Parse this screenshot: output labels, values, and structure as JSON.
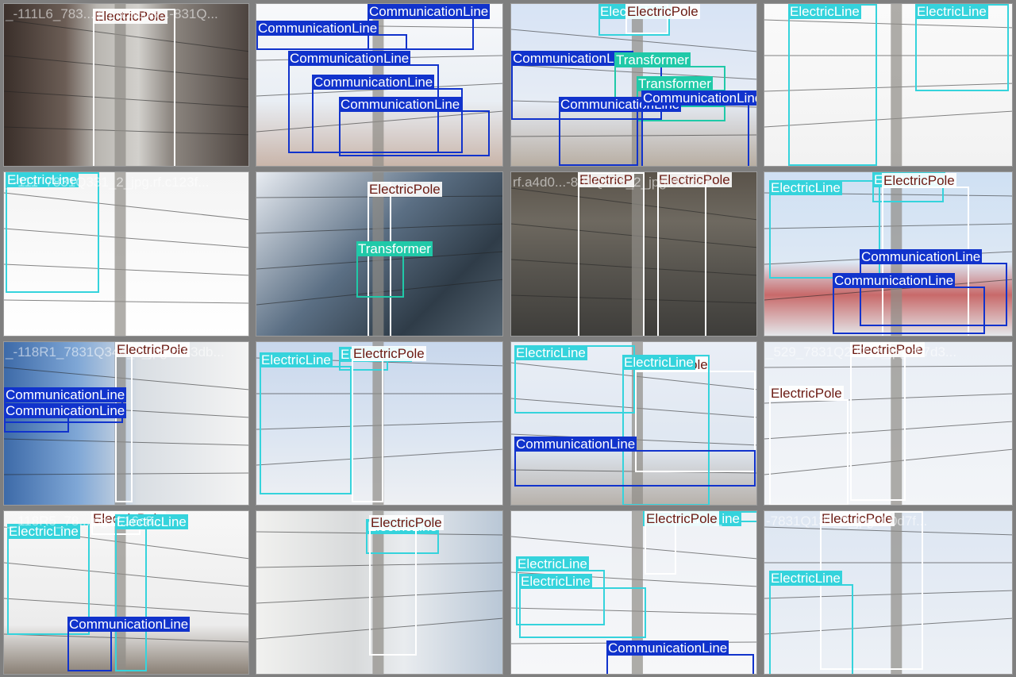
{
  "colors": {
    "background": "#7f7f7f",
    "ElectricPole": "#ffffff",
    "ElectricPole_text": "#6b1a12",
    "ElectricLine": "#35d3dc",
    "ElectricLine_text": "#ffffff",
    "CommunicationLine": "#1133cc",
    "CommunicationLine_text": "#ffffff",
    "Transformer": "#20c9a8",
    "Transformer_text": "#ffffff"
  },
  "tiles": [
    {
      "filename": "_-111L6_783...jpg.rf.b608...-831Q...",
      "scene": "concrete-pole-closeup",
      "labels": [
        {
          "cls": "ElectricPole",
          "text": "ElectricPole"
        }
      ]
    },
    {
      "filename": "",
      "scene": "sky-wires-building",
      "labels": [
        {
          "cls": "CommunicationLine",
          "text": "CommunicationLine"
        },
        {
          "cls": "CommunicationLine",
          "text": "CommunicationLine"
        },
        {
          "cls": "CommunicationLine",
          "text": "CommunicationLine"
        },
        {
          "cls": "CommunicationLine",
          "text": "CommunicationLine"
        },
        {
          "cls": "CommunicationLine",
          "text": "CommunicationLine"
        }
      ]
    },
    {
      "filename": "",
      "scene": "sky-pole-lamp",
      "labels": [
        {
          "cls": "ElectricLine",
          "text": "ElectricLine"
        },
        {
          "cls": "ElectricPole",
          "text": "ElectricPole"
        },
        {
          "cls": "CommunicationLine",
          "text": "CommunicationLine"
        },
        {
          "cls": "Transformer",
          "text": "Transformer"
        },
        {
          "cls": "Transformer",
          "text": "Transformer"
        },
        {
          "cls": "CommunicationLine",
          "text": "CommunicationLine"
        },
        {
          "cls": "CommunicationLine",
          "text": "CommunicationLine"
        }
      ]
    },
    {
      "filename": "",
      "scene": "insulator-closeup-bright",
      "labels": [
        {
          "cls": "ElectricLine",
          "text": "ElectricLine"
        },
        {
          "cls": "ElectricLine",
          "text": "ElectricLine"
        }
      ]
    },
    {
      "filename": "_-111_7831Q331_2_jpg.rf.c123f...",
      "scene": "insulator-dark",
      "labels": [
        {
          "cls": "ElectricLine",
          "text": "ElectricLine"
        }
      ]
    },
    {
      "filename": "",
      "scene": "blue-building",
      "labels": [
        {
          "cls": "ElectricPole",
          "text": "ElectricPole"
        },
        {
          "cls": "Transformer",
          "text": "Transformer"
        }
      ]
    },
    {
      "filename": "rf.a4d0...-831Q462_2_jpg.rf.0dec...",
      "scene": "stone-wall-poles",
      "labels": [
        {
          "cls": "ElectricPole",
          "text": "ElectricP"
        },
        {
          "cls": "ElectricPole",
          "text": "ElectricPole"
        }
      ]
    },
    {
      "filename": "",
      "scene": "sky-red-sign",
      "labels": [
        {
          "cls": "ElectricLine",
          "text": "ElectricLine"
        },
        {
          "cls": "ElectricLine",
          "text": "ElectricLine"
        },
        {
          "cls": "ElectricPole",
          "text": "ElectricPole"
        },
        {
          "cls": "CommunicationLine",
          "text": "CommunicationLine"
        },
        {
          "cls": "CommunicationLine",
          "text": "CommunicationLine"
        }
      ]
    },
    {
      "filename": "_-118R1_7831Q344_2_jpg.rf.83db...",
      "scene": "glass-building",
      "labels": [
        {
          "cls": "ElectricPole",
          "text": "ElectricPole"
        },
        {
          "cls": "CommunicationLine",
          "text": "CommunicationLine"
        },
        {
          "cls": "CommunicationLine",
          "text": "CommunicationLine"
        }
      ]
    },
    {
      "filename": "",
      "scene": "sky-pole-crossarms",
      "labels": [
        {
          "cls": "ElectricLine",
          "text": "ElectricLine"
        },
        {
          "cls": "ElectricLine",
          "text": "ElectricLine"
        },
        {
          "cls": "ElectricPole",
          "text": "ElectricPole"
        }
      ]
    },
    {
      "filename": "",
      "scene": "sky-wires-trees",
      "labels": [
        {
          "cls": "ElectricLine",
          "text": "ElectricLine"
        },
        {
          "cls": "ElectricPole",
          "text": "ElectricPole"
        },
        {
          "cls": "ElectricLine",
          "text": "ElectricLine"
        },
        {
          "cls": "CommunicationLine",
          "text": "CommunicationLine"
        }
      ]
    },
    {
      "filename": "_529_7831Q232_2_jpg.rf.7d3...",
      "scene": "sky-insulators",
      "labels": [
        {
          "cls": "ElectricPole",
          "text": "ElectricPole"
        },
        {
          "cls": "ElectricPole",
          "text": "ElectricPole"
        }
      ]
    },
    {
      "filename": "_-118R5_78...jpg.rf.16c8...",
      "scene": "sky-trees-pole",
      "labels": [
        {
          "cls": "ElectricLine",
          "text": "ElectricLine"
        },
        {
          "cls": "ElectricPole",
          "text": "ElectricPole"
        },
        {
          "cls": "ElectricLine",
          "text": "ElectricLine"
        },
        {
          "cls": "CommunicationLine",
          "text": "CommunicationLine"
        }
      ]
    },
    {
      "filename": "",
      "scene": "white-buildings-pole",
      "labels": [
        {
          "cls": "ElectricLine",
          "text": "ElectricLine"
        },
        {
          "cls": "ElectricPole",
          "text": "ElectricPole"
        }
      ]
    },
    {
      "filename": "",
      "scene": "sky-pole-wires",
      "labels": [
        {
          "cls": "ElectricLine",
          "text": "ElectricLine_ine"
        },
        {
          "cls": "ElectricPole",
          "text": "ElectricPole"
        },
        {
          "cls": "ElectricLine",
          "text": "ElectricLine"
        },
        {
          "cls": "ElectricLine",
          "text": "ElectricLine"
        },
        {
          "cls": "CommunicationLine",
          "text": "CommunicationLine"
        }
      ]
    },
    {
      "filename": "-7831Q131_2_jpg.rf.0d7f...",
      "scene": "sky-cutouts",
      "labels": [
        {
          "cls": "ElectricPole",
          "text": "ElectricPole"
        },
        {
          "cls": "ElectricLine",
          "text": "ElectricLine"
        }
      ]
    }
  ]
}
